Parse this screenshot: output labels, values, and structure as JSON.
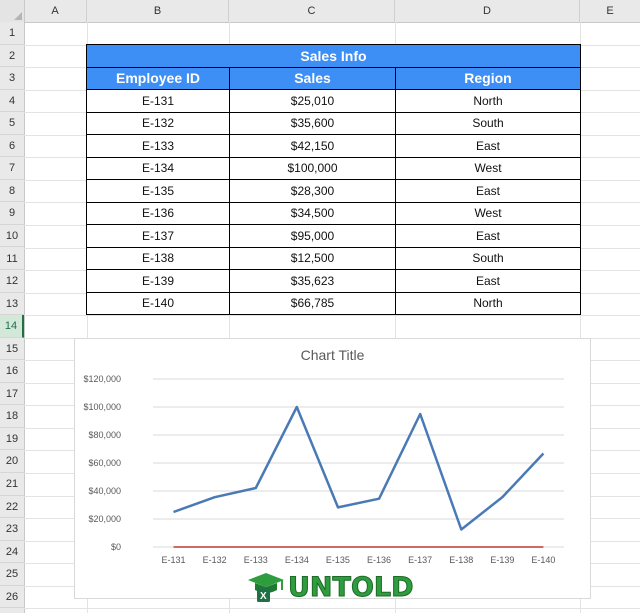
{
  "columns": [
    "A",
    "B",
    "C",
    "D",
    "E"
  ],
  "rows": [
    "1",
    "2",
    "3",
    "4",
    "5",
    "6",
    "7",
    "8",
    "9",
    "10",
    "11",
    "12",
    "13",
    "14",
    "15",
    "16",
    "17",
    "18",
    "19",
    "20",
    "21",
    "22",
    "23",
    "24",
    "25",
    "26"
  ],
  "active_row": "14",
  "table": {
    "title": "Sales Info",
    "headers": [
      "Employee ID",
      "Sales",
      "Region"
    ],
    "rows": [
      [
        "E-131",
        "$25,010",
        "North"
      ],
      [
        "E-132",
        "$35,600",
        "South"
      ],
      [
        "E-133",
        "$42,150",
        "East"
      ],
      [
        "E-134",
        "$100,000",
        "West"
      ],
      [
        "E-135",
        "$28,300",
        "East"
      ],
      [
        "E-136",
        "$34,500",
        "West"
      ],
      [
        "E-137",
        "$95,000",
        "East"
      ],
      [
        "E-138",
        "$12,500",
        "South"
      ],
      [
        "E-139",
        "$35,623",
        "East"
      ],
      [
        "E-140",
        "$66,785",
        "North"
      ]
    ]
  },
  "chart_data": {
    "type": "line",
    "title": "Chart Title",
    "categories": [
      "E-131",
      "E-132",
      "E-133",
      "E-134",
      "E-135",
      "E-136",
      "E-137",
      "E-138",
      "E-139",
      "E-140"
    ],
    "series": [
      {
        "values": [
          25010,
          35600,
          42150,
          100000,
          28300,
          34500,
          95000,
          12500,
          35623,
          66785
        ],
        "color": "#4a7ab5"
      },
      {
        "values": [
          0,
          0,
          0,
          0,
          0,
          0,
          0,
          0,
          0,
          0
        ],
        "color": "#c0392b"
      }
    ],
    "ylim": [
      0,
      120000
    ],
    "yticks": [
      "$0",
      "$20,000",
      "$40,000",
      "$60,000",
      "$80,000",
      "$100,000",
      "$120,000"
    ],
    "grid": true,
    "legend": "none"
  },
  "logo": {
    "text": "UNTOLD",
    "icon": "graduation-cap-excel-icon"
  },
  "colors": {
    "header_blue": "#3d8ef5",
    "line_blue": "#4a7ab5",
    "line_red": "#c0392b",
    "logo_green": "#2f9c3d"
  }
}
